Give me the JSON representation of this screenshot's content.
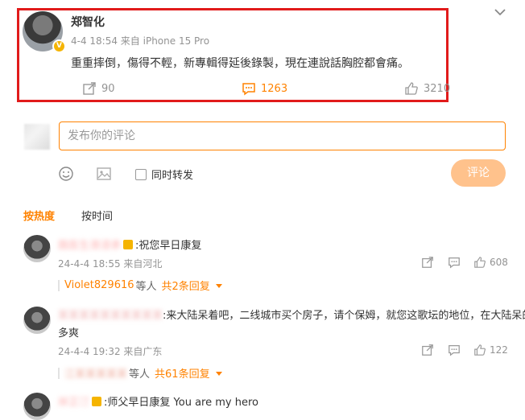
{
  "post": {
    "username": "郑智化",
    "time_source": "4-4 18:54 来自 iPhone 15 Pro",
    "text": "重重摔倒，傷得不輕，新專輯得延後錄製，現在連說話胸腔都會痛。",
    "repost_count": "90",
    "comment_count": "1263",
    "like_count": "3210",
    "verified_badge": "V"
  },
  "composer": {
    "placeholder": "发布你的评论",
    "repost_checkbox_label": "同时转发",
    "submit_label": "评论"
  },
  "tabs": {
    "hot": "按热度",
    "time": "按时间"
  },
  "comments": [
    {
      "name_blurred": "路医生滑浸承",
      "text": ":祝您早日康复",
      "time_source": "24-4-4 18:55 来自河北",
      "like_count": "608",
      "reply_user": "Violet829616",
      "reply_suffix": "等人",
      "reply_count_label": "共2条回复"
    },
    {
      "name_blurred": "某某某某某某某某某某",
      "text": ":来大陆呆着吧，二线城市买个房子，请个保姆，就您这歌坛的地位，在大陆呆的",
      "text_line2": "多爽",
      "time_source": "24-4-4 19:32 来自广东",
      "like_count": "122",
      "reply_user_blurred": "江某某某某某",
      "reply_suffix": "等人",
      "reply_count_label": "共61条回复"
    },
    {
      "name_blurred": "岸芷汀",
      "text": ":师父早日康复 You are my hero"
    }
  ],
  "colors": {
    "accent": "#ff8200",
    "highlight_border": "#e11b1b",
    "muted": "#939393"
  }
}
